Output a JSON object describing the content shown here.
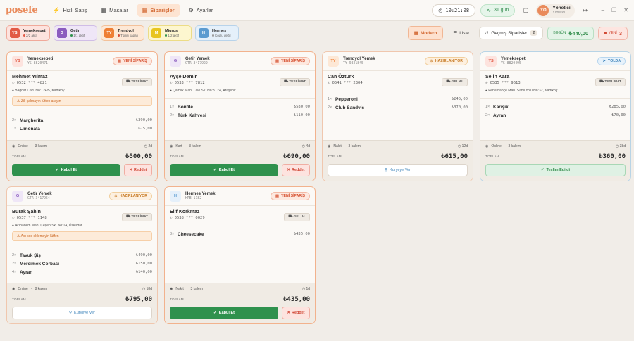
{
  "app": {
    "logo": "posefe"
  },
  "nav": [
    {
      "label": "Hızlı Satış",
      "icon": "⚡"
    },
    {
      "label": "Masalar",
      "icon": "▦"
    },
    {
      "label": "Siparişler",
      "icon": "▤"
    },
    {
      "label": "Ayarlar",
      "icon": "⚙"
    }
  ],
  "topbar": {
    "clock": "10:21:08",
    "trial": "31 gün",
    "user_initials": "YO",
    "user_name": "Yönetici",
    "user_role": "Yönetici"
  },
  "sources": [
    {
      "abbr": "YS",
      "name": "Yemeksepeti",
      "count": "2/2 aktif",
      "bg": "#fde3de",
      "border": "#f0a99a",
      "badge": "#e25a45",
      "dot": "#e25a45"
    },
    {
      "abbr": "G",
      "name": "Getir",
      "count": "1/1 aktif",
      "bg": "#efe6f7",
      "border": "#d0bde6",
      "badge": "#8b5cbf",
      "dot": "#2f914d"
    },
    {
      "abbr": "TY",
      "name": "Trendyol",
      "count": "Tümü kapalı",
      "bg": "#fde8d6",
      "border": "#f3c19a",
      "badge": "#ee7f35",
      "dot": "#d24a35"
    },
    {
      "abbr": "M",
      "name": "Migros",
      "count": "1/2 aktif",
      "bg": "#fdf6cf",
      "border": "#ecdc86",
      "badge": "#e8c520",
      "dot": "#2f914d"
    },
    {
      "abbr": "H",
      "name": "Hermes",
      "count": "Kodlu değil",
      "bg": "#e5f0fa",
      "border": "#b8d3ea",
      "badge": "#5b9bd0",
      "dot": "#999999"
    }
  ],
  "filters": {
    "modern": "Modern",
    "list": "Liste",
    "past": "Geçmiş Siparişler",
    "past_count": "2",
    "today_label": "BUGÜN",
    "today_value": "₺440,00",
    "new_label": "YENİ",
    "new_value": "3"
  },
  "labels": {
    "total": "TOPLAM",
    "accept": "Kabul Et",
    "reject": "Reddet",
    "courier": "Kuryeye Ver",
    "delivered": "Teslim Edildi"
  },
  "orders": [
    {
      "src": "Yemeksepeti",
      "abbr": "YS",
      "id": "YS-8820471",
      "status": "YENİ SİPARİŞ",
      "customer": "Mehmet Yılmaz",
      "phone": "0532 *** 4821",
      "dtype": "TESLİMAT",
      "address": "Bağdat Cad. No:124/5, Kadıköy",
      "note": "Zili çalmayın lütfen arayın",
      "items": [
        {
          "q": "2×",
          "n": "Margherita",
          "p": "₺390,00"
        },
        {
          "q": "1×",
          "n": "Limonata",
          "p": "₺75,00"
        }
      ],
      "pay": "Online",
      "kalem": "3 kalem",
      "time": "2d",
      "total": "₺500,00"
    },
    {
      "src": "Getir Yemek",
      "abbr": "G",
      "id": "GTR-3417929",
      "status": "YENİ SİPARİŞ",
      "customer": "Ayşe Demir",
      "phone": "0533 *** 7812",
      "dtype": "TESLİMAT",
      "address": "Çamlık Mah. Lale Sk. No:8 D:4, Ataşehir",
      "note": "",
      "items": [
        {
          "q": "1×",
          "n": "Bonfile",
          "p": "₺580,00"
        },
        {
          "q": "2×",
          "n": "Türk Kahvesi",
          "p": "₺110,00"
        }
      ],
      "pay": "Kart",
      "kalem": "3 kalem",
      "time": "4d",
      "total": "₺690,00"
    },
    {
      "src": "Trendyol Yemek",
      "abbr": "TY",
      "id": "TY-9821845",
      "status": "HAZIRLANIYOR",
      "customer": "Can Öztürk",
      "phone": "0541 *** 2304",
      "dtype": "GEL AL",
      "address": "",
      "note": "",
      "items": [
        {
          "q": "1×",
          "n": "Pepperoni",
          "p": "₺245,00"
        },
        {
          "q": "2×",
          "n": "Club Sandviç",
          "p": "₺370,00"
        }
      ],
      "pay": "Nakit",
      "kalem": "3 kalem",
      "time": "12d",
      "total": "₺615,00"
    },
    {
      "src": "Yemeksepeti",
      "abbr": "YS",
      "id": "YS-8820495",
      "status": "YOLDA",
      "customer": "Selin Kara",
      "phone": "0535 *** 9613",
      "dtype": "TESLİMAT",
      "address": "Fenerbahçe Mah. Sahil Yolu No:32, Kadıköy",
      "note": "",
      "items": [
        {
          "q": "1×",
          "n": "Karışık",
          "p": "₺285,00"
        },
        {
          "q": "2×",
          "n": "Ayran",
          "p": "₺70,00"
        }
      ],
      "pay": "Online",
      "kalem": "3 kalem",
      "time": "38d",
      "total": "₺360,00"
    },
    {
      "src": "Getir Yemek",
      "abbr": "G",
      "id": "GTR-3417954",
      "status": "HAZIRLANIYOR",
      "customer": "Burak Şahin",
      "phone": "0537 *** 1148",
      "dtype": "TESLİMAT",
      "address": "Acıbadem Mah. Çeçen Sk. No:14, Üsküdar",
      "note": "Acı sos eklemeyin lütfen",
      "items": [
        {
          "q": "2×",
          "n": "Tavuk Şiş",
          "p": "₺490,00"
        },
        {
          "q": "2×",
          "n": "Mercimek Çorbası",
          "p": "₺150,00"
        },
        {
          "q": "4×",
          "n": "Ayran",
          "p": "₺140,00"
        }
      ],
      "pay": "Online",
      "kalem": "8 kalem",
      "time": "18d",
      "total": "₺795,00"
    },
    {
      "src": "Hermes Yemek",
      "abbr": "H",
      "id": "HRB-1182",
      "status": "YENİ SİPARİŞ",
      "customer": "Elif Korkmaz",
      "phone": "0538 *** 0029",
      "dtype": "GEL AL",
      "address": "",
      "note": "",
      "items": [
        {
          "q": "3×",
          "n": "Cheesecake",
          "p": "₺435,00"
        }
      ],
      "pay": "Nakit",
      "kalem": "3 kalem",
      "time": "1d",
      "total": "₺435,00"
    }
  ]
}
